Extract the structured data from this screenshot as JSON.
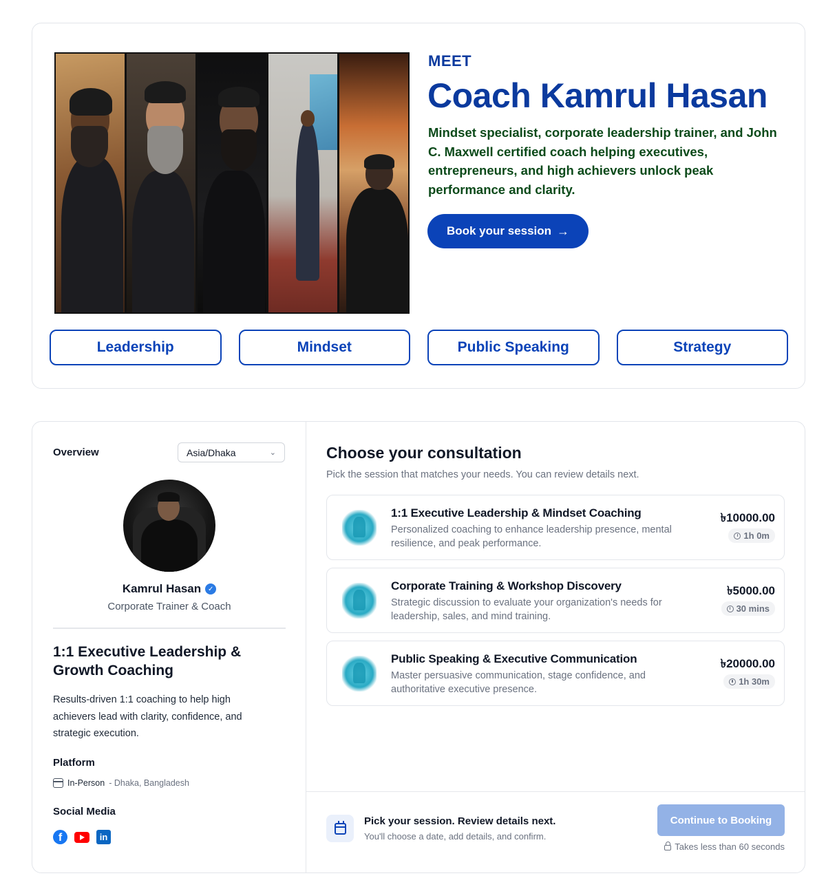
{
  "hero": {
    "eyebrow": "MEET",
    "title": "Coach Kamrul Hasan",
    "tagline": "Mindset specialist, corporate leadership trainer, and John C. Maxwell certified coach helping executives, entrepreneurs, and high achievers unlock peak performance and clarity.",
    "cta_label": "Book your session",
    "cta_icon": "arrow-right-icon",
    "tags": [
      "Leadership",
      "Mindset",
      "Public Speaking",
      "Strategy"
    ]
  },
  "sidebar": {
    "overview_label": "Overview",
    "timezone": "Asia/Dhaka",
    "coach_name": "Kamrul Hasan",
    "coach_role": "Corporate Trainer & Coach",
    "program_title": "1:1 Executive Leadership & Growth Coaching",
    "program_desc": "Results-driven 1:1 coaching to help high achievers lead with clarity, confidence, and strategic execution.",
    "platform_heading": "Platform",
    "platform_type": "In-Person",
    "platform_location": "- Dhaka, Bangladesh",
    "social_heading": "Social Media",
    "social": [
      "facebook-icon",
      "youtube-icon",
      "linkedin-icon"
    ]
  },
  "main": {
    "heading": "Choose your consultation",
    "subheading": "Pick the session that matches your needs. You can review details next.",
    "sessions": [
      {
        "title": "1:1 Executive Leadership & Mindset Coaching",
        "desc": "Personalized coaching to enhance leadership presence, mental resilience, and peak performance.",
        "price": "৳10000.00",
        "duration": "1h 0m"
      },
      {
        "title": "Corporate Training & Workshop Discovery",
        "desc": "Strategic discussion to evaluate your organization's needs for leadership, sales, and mind training.",
        "price": "৳5000.00",
        "duration": "30 mins"
      },
      {
        "title": "Public Speaking & Executive Communication",
        "desc": "Master persuasive communication, stage confidence, and authoritative executive presence.",
        "price": "৳20000.00",
        "duration": "1h 30m"
      }
    ],
    "footer": {
      "title": "Pick your session. Review details next.",
      "subtitle": "You'll choose a date, add details, and confirm.",
      "button_label": "Continue to Booking",
      "note": "Takes less than 60 seconds"
    }
  },
  "colors": {
    "brand_blue": "#0b43b8",
    "title_blue": "#0b3a9e",
    "tagline_green": "#0c4a1a",
    "disabled_button": "#93b2e6"
  }
}
